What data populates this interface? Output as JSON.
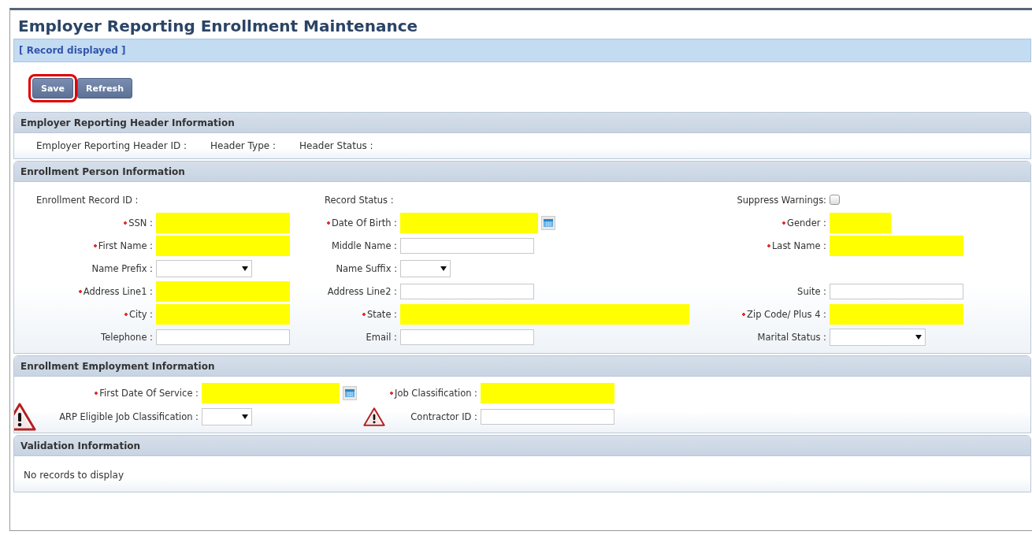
{
  "title": "Employer Reporting Enrollment Maintenance",
  "status_message": "[ Record displayed ]",
  "buttons": [
    {
      "label": "Save",
      "highlighted": true
    },
    {
      "label": "Refresh",
      "highlighted": false
    }
  ],
  "sections": [
    {
      "title": "Employer Reporting Header Information",
      "kind": "inline",
      "items": [
        {
          "label": "Employer Reporting Header ID :"
        },
        {
          "label": "Header Type :"
        },
        {
          "label": "Header Status :"
        }
      ]
    },
    {
      "title": "Enrollment Person Information",
      "kind": "grid",
      "rows": [
        [
          {
            "label": "Enrollment Record ID :",
            "kind": "display"
          },
          {
            "label": "Record Status :",
            "kind": "display"
          },
          {
            "label": "Suppress Warnings:",
            "kind": "checkbox",
            "checked": false
          }
        ],
        [
          {
            "label": "SSN :",
            "kind": "text",
            "required": true,
            "redacted": true
          },
          {
            "label": "Date Of Birth :",
            "kind": "date",
            "required": true,
            "redacted": true
          },
          {
            "label": "Gender :",
            "kind": "short",
            "required": true,
            "redacted": true
          }
        ],
        [
          {
            "label": "First Name :",
            "kind": "text",
            "required": true,
            "redacted": true
          },
          {
            "label": "Middle Name :",
            "kind": "text",
            "required": false,
            "redacted": false
          },
          {
            "label": "Last Name :",
            "kind": "text",
            "required": true,
            "redacted": true
          }
        ],
        [
          {
            "label": "Name Prefix :",
            "kind": "select",
            "required": false
          },
          {
            "label": "Name Suffix :",
            "kind": "select-small",
            "required": false
          },
          null
        ],
        [
          {
            "label": "Address Line1 :",
            "kind": "text",
            "required": true,
            "redacted": true
          },
          {
            "label": "Address Line2 :",
            "kind": "text",
            "required": false,
            "redacted": false
          },
          {
            "label": "Suite :",
            "kind": "text",
            "required": false,
            "redacted": false
          }
        ],
        [
          {
            "label": "City :",
            "kind": "text",
            "required": true,
            "redacted": true
          },
          {
            "label": "State :",
            "kind": "wide",
            "required": true,
            "redacted": true
          },
          {
            "label": "Zip Code/ Plus 4 :",
            "kind": "text",
            "required": true,
            "redacted": true
          }
        ],
        [
          {
            "label": "Telephone :",
            "kind": "text",
            "required": false,
            "redacted": false
          },
          {
            "label": "Email :",
            "kind": "text",
            "required": false,
            "redacted": false
          },
          {
            "label": "Marital Status :",
            "kind": "select",
            "required": false
          }
        ]
      ]
    },
    {
      "title": "Enrollment Employment Information",
      "kind": "employment",
      "rows": [
        [
          {
            "label": "First Date Of Service :",
            "kind": "date",
            "required": true,
            "redacted": true,
            "warning": false
          },
          {
            "label": "Job Classification :",
            "kind": "text",
            "required": true,
            "redacted": true,
            "warning": false
          }
        ],
        [
          {
            "label": "ARP Eligible Job Classification :",
            "kind": "select-small",
            "required": false,
            "warning": true
          },
          {
            "label": "Contractor ID :",
            "kind": "text",
            "required": false,
            "redacted": false,
            "warning": true
          }
        ]
      ]
    },
    {
      "title": "Validation Information",
      "kind": "message",
      "text": "No records to display"
    }
  ]
}
